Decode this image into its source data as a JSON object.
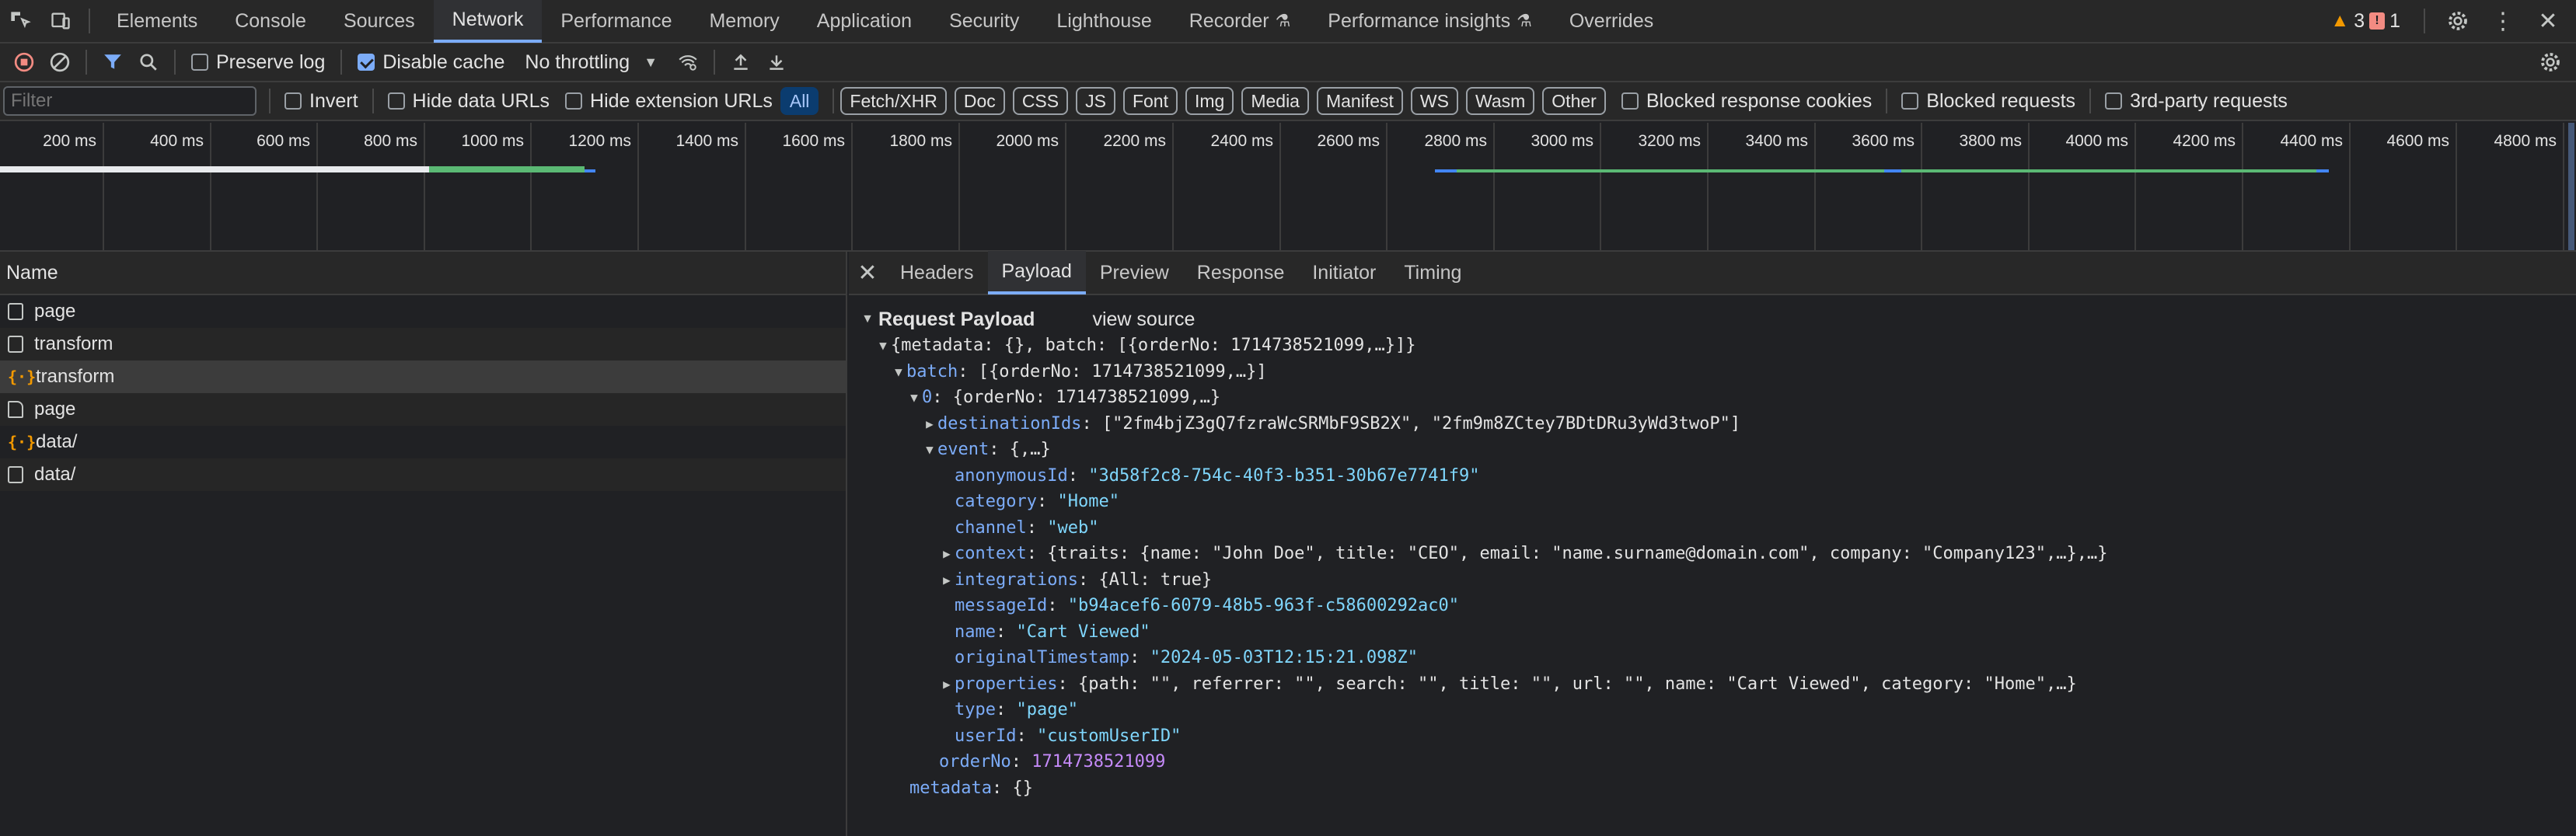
{
  "topbar": {
    "tabs": [
      "Elements",
      "Console",
      "Sources",
      "Network",
      "Performance",
      "Memory",
      "Application",
      "Security",
      "Lighthouse",
      "Recorder",
      "Performance insights",
      "Overrides"
    ],
    "active_tab": "Network",
    "warnings_count": "3",
    "errors_count": "1"
  },
  "toolbar": {
    "preserve_log": "Preserve log",
    "disable_cache": "Disable cache",
    "throttling": "No throttling"
  },
  "filter": {
    "placeholder": "Filter",
    "invert": "Invert",
    "hide_data_urls": "Hide data URLs",
    "hide_extension_urls": "Hide extension URLs",
    "types": [
      "All",
      "Fetch/XHR",
      "Doc",
      "CSS",
      "JS",
      "Font",
      "Img",
      "Media",
      "Manifest",
      "WS",
      "Wasm",
      "Other"
    ],
    "active_type": "All",
    "blocked_response_cookies": "Blocked response cookies",
    "blocked_requests": "Blocked requests",
    "third_party": "3rd-party requests"
  },
  "timeline": {
    "ticks": [
      "200 ms",
      "400 ms",
      "600 ms",
      "800 ms",
      "1000 ms",
      "1200 ms",
      "1400 ms",
      "1600 ms",
      "1800 ms",
      "2000 ms",
      "2200 ms",
      "2400 ms",
      "2600 ms",
      "2800 ms",
      "3000 ms",
      "3200 ms",
      "3400 ms",
      "3600 ms",
      "3800 ms",
      "4000 ms",
      "4200 ms",
      "4400 ms",
      "4600 ms",
      "4800 ms"
    ]
  },
  "requests": {
    "header": "Name",
    "rows": [
      {
        "name": "page",
        "type": "doc"
      },
      {
        "name": "transform",
        "type": "doc"
      },
      {
        "name": "transform",
        "type": "json"
      },
      {
        "name": "page",
        "type": "file"
      },
      {
        "name": "data/",
        "type": "json"
      },
      {
        "name": "data/",
        "type": "doc"
      }
    ]
  },
  "details": {
    "tabs": [
      "Headers",
      "Payload",
      "Preview",
      "Response",
      "Initiator",
      "Timing"
    ],
    "active_tab": "Payload",
    "section_title": "Request Payload",
    "view_source": "view source",
    "root_summary": "{metadata: {}, batch: [{orderNo: 1714738521099,…}]}",
    "batch_key": "batch",
    "batch_summary": "[{orderNo: 1714738521099,…}]",
    "item_key": "0",
    "item_summary": "{orderNo: 1714738521099,…}",
    "destination_key": "destinationIds",
    "destination_summary": "[\"2fm4bjZ3gQ7fzraWcSRMbF9SB2X\", \"2fm9m8ZCtey7BDtDRu3yWd3twoP\"]",
    "event_key": "event",
    "event_summary": "{,…}",
    "anonymous_key": "anonymousId",
    "anonymous_val": "\"3d58f2c8-754c-40f3-b351-30b67e7741f9\"",
    "category_key": "category",
    "category_val": "\"Home\"",
    "channel_key": "channel",
    "channel_val": "\"web\"",
    "context_key": "context",
    "context_summary": "{traits: {name: \"John Doe\", title: \"CEO\", email: \"name.surname@domain.com\", company: \"Company123\",…},…}",
    "integrations_key": "integrations",
    "integrations_summary": "{All: true}",
    "message_key": "messageId",
    "message_val": "\"b94acef6-6079-48b5-963f-c58600292ac0\"",
    "name_key": "name",
    "name_val": "\"Cart Viewed\"",
    "orig_key": "originalTimestamp",
    "orig_val": "\"2024-05-03T12:15:21.098Z\"",
    "properties_key": "properties",
    "properties_summary": "{path: \"\", referrer: \"\", search: \"\", title: \"\", url: \"\", name: \"Cart Viewed\", category: \"Home\",…}",
    "type_key": "type",
    "type_val": "\"page\"",
    "user_key": "userId",
    "user_val": "\"customUserID\"",
    "order_key": "orderNo",
    "order_val": "1714738521099",
    "metadata_key": "metadata",
    "metadata_val": "{}"
  }
}
